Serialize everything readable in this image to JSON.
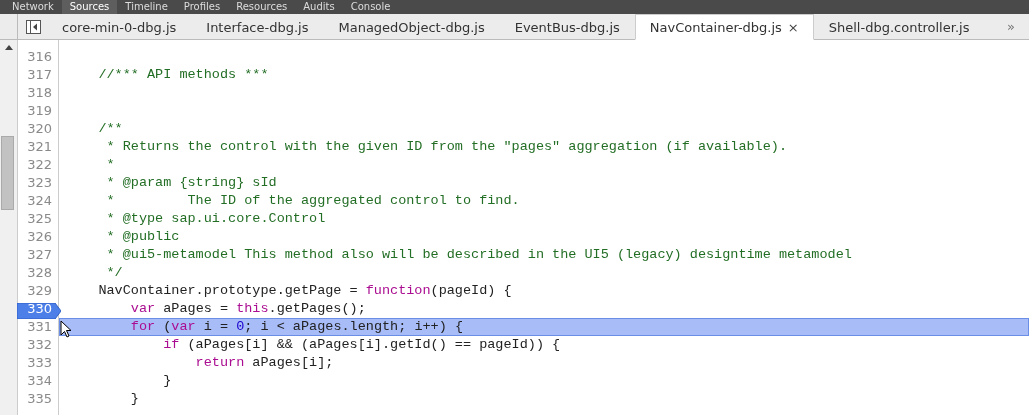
{
  "menu": [
    {
      "label": "Network",
      "selected": false
    },
    {
      "label": "Sources",
      "selected": true
    },
    {
      "label": "Timeline",
      "selected": false
    },
    {
      "label": "Profiles",
      "selected": false
    },
    {
      "label": "Resources",
      "selected": false
    },
    {
      "label": "Audits",
      "selected": false
    },
    {
      "label": "Console",
      "selected": false
    }
  ],
  "tabs": [
    {
      "label": "core-min-0-dbg.js",
      "selected": false
    },
    {
      "label": "Interface-dbg.js",
      "selected": false
    },
    {
      "label": "ManagedObject-dbg.js",
      "selected": false
    },
    {
      "label": "EventBus-dbg.js",
      "selected": false
    },
    {
      "label": "NavContainer-dbg.js",
      "selected": true,
      "close": "×"
    },
    {
      "label": "Shell-dbg.controller.js",
      "selected": false
    }
  ],
  "overflow": "»",
  "lines": [
    {
      "number": "316",
      "breakpoint": false,
      "current": false
    },
    {
      "number": "317",
      "breakpoint": false,
      "current": false,
      "segments": [
        {
          "kind": "comment",
          "text": "    //*** API methods ***"
        }
      ]
    },
    {
      "number": "318",
      "breakpoint": false,
      "current": false
    },
    {
      "number": "319",
      "breakpoint": false,
      "current": false
    },
    {
      "number": "320",
      "breakpoint": false,
      "current": false,
      "segments": [
        {
          "kind": "comment",
          "text": "    /**"
        }
      ]
    },
    {
      "number": "321",
      "breakpoint": false,
      "current": false,
      "segments": [
        {
          "kind": "comment",
          "text": "     * Returns the control with the given ID from the \"pages\" aggregation (if available)."
        }
      ]
    },
    {
      "number": "322",
      "breakpoint": false,
      "current": false,
      "segments": [
        {
          "kind": "comment",
          "text": "     *"
        }
      ]
    },
    {
      "number": "323",
      "breakpoint": false,
      "current": false,
      "segments": [
        {
          "kind": "comment",
          "text": "     * @param {string} sId"
        }
      ]
    },
    {
      "number": "324",
      "breakpoint": false,
      "current": false,
      "segments": [
        {
          "kind": "comment",
          "text": "     *         The ID of the aggregated control to find."
        }
      ]
    },
    {
      "number": "325",
      "breakpoint": false,
      "current": false,
      "segments": [
        {
          "kind": "comment",
          "text": "     * @type sap.ui.core.Control"
        }
      ]
    },
    {
      "number": "326",
      "breakpoint": false,
      "current": false,
      "segments": [
        {
          "kind": "comment",
          "text": "     * @public"
        }
      ]
    },
    {
      "number": "327",
      "breakpoint": false,
      "current": false,
      "segments": [
        {
          "kind": "comment",
          "text": "     * @ui5-metamodel This method also will be described in the UI5 (legacy) designtime metamodel"
        }
      ]
    },
    {
      "number": "328",
      "breakpoint": false,
      "current": false,
      "segments": [
        {
          "kind": "comment",
          "text": "     */"
        }
      ]
    },
    {
      "number": "329",
      "breakpoint": false,
      "current": false,
      "segments": [
        {
          "kind": "plain",
          "text": "    NavContainer.prototype.getPage = "
        },
        {
          "kind": "keyword",
          "text": "function"
        },
        {
          "kind": "plain",
          "text": "(pageId) {"
        }
      ]
    },
    {
      "number": "330",
      "breakpoint": true,
      "current": false,
      "segments": [
        {
          "kind": "keyword",
          "text": "        var"
        },
        {
          "kind": "plain",
          "text": " aPages = "
        },
        {
          "kind": "keyword",
          "text": "this"
        },
        {
          "kind": "plain",
          "text": ".getPages();"
        }
      ]
    },
    {
      "number": "331",
      "breakpoint": false,
      "current": true,
      "segments": [
        {
          "kind": "keyword",
          "text": "        for"
        },
        {
          "kind": "plain",
          "text": " ("
        },
        {
          "kind": "keyword",
          "text": "var"
        },
        {
          "kind": "plain",
          "text": " i = "
        },
        {
          "kind": "number",
          "text": "0"
        },
        {
          "kind": "plain",
          "text": "; i < aPages.length; i++) {"
        }
      ]
    },
    {
      "number": "332",
      "breakpoint": false,
      "current": false,
      "segments": [
        {
          "kind": "keyword",
          "text": "            if"
        },
        {
          "kind": "plain",
          "text": " (aPages[i] && (aPages[i].getId() == pageId)) {"
        }
      ]
    },
    {
      "number": "333",
      "breakpoint": false,
      "current": false,
      "segments": [
        {
          "kind": "keyword",
          "text": "                return"
        },
        {
          "kind": "plain",
          "text": " aPages[i];"
        }
      ]
    },
    {
      "number": "334",
      "breakpoint": false,
      "current": false,
      "segments": [
        {
          "kind": "plain",
          "text": "            }"
        }
      ]
    },
    {
      "number": "335",
      "breakpoint": false,
      "current": false,
      "segments": [
        {
          "kind": "plain",
          "text": "        }"
        }
      ]
    }
  ]
}
